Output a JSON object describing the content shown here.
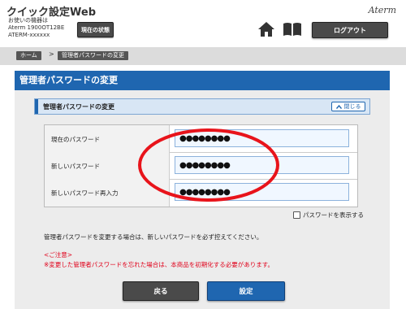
{
  "header": {
    "app_title": "クイック設定Web",
    "device_info": {
      "line1": "お使いの機器は",
      "line2": "Aterm 1900OT12BE",
      "line3": "ATERM-xxxxxx"
    },
    "status_button": "現在の状態",
    "brand": "Aterm",
    "home_icon": "home-icon",
    "manual_icon": "book-icon",
    "logout_button": "ログアウト"
  },
  "breadcrumb": {
    "home": "ホーム",
    "separator": ">",
    "current": "管理者パスワードの変更"
  },
  "page": {
    "title": "管理者パスワードの変更"
  },
  "section": {
    "title": "管理者パスワードの変更",
    "close_button": "閉じる",
    "close_icon": "chevron-up-icon"
  },
  "form": {
    "rows": [
      {
        "label": "現在のパスワード",
        "value": "●●●●●●●●"
      },
      {
        "label": "新しいパスワード",
        "value": "●●●●●●●●"
      },
      {
        "label": "新しいパスワード再入力",
        "value": "●●●●●●●●"
      }
    ],
    "show_password_label": "パスワードを表示する",
    "show_password_checked": false
  },
  "notes": {
    "instruction": "管理者パスワードを変更する場合は、新しいパスワードを必ず控えてください。",
    "caution_title": "<ご注意>",
    "caution_text": "※変更した管理者パスワードを忘れた場合は、本商品を初期化する必要があります。"
  },
  "buttons": {
    "back": "戻る",
    "settings": "設定"
  },
  "colors": {
    "primary": "#1f66b0",
    "button_dark": "#4a4a4a",
    "caution": "#e0001a",
    "annotation": "#e8141b"
  }
}
